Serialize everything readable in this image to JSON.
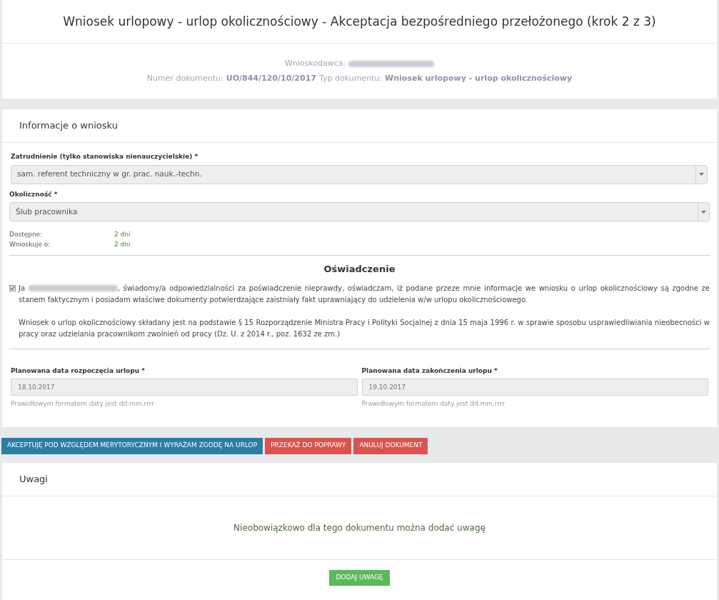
{
  "title": "Wniosek urlopowy - urlop okolicznościowy - Akceptacja bezpośredniego przełożonego (krok 2 z 3)",
  "header": {
    "applicant_label": "Wnioskodawca:",
    "doc_number_label": "Numer dokumentu:",
    "doc_number": "UO/844/120/10/2017",
    "doc_type_label": "Typ dokumentu:",
    "doc_type": "Wniosek urlopowy - urlop okolicznościowy"
  },
  "info": {
    "title": "Informacje o wniosku",
    "selects": [
      {
        "label": "Zatrudnienie (tylko stanowiska nienauczycielskie) *",
        "value": "sam. referent techniczny w gr. prac. nauk.-techn."
      },
      {
        "label": "Okoliczność *",
        "value": "Ślub pracownika"
      }
    ],
    "summary": [
      {
        "label": "Dostępne:",
        "value": "2 dni"
      },
      {
        "label": "Wnioskuje o:",
        "value": "2 dni"
      }
    ],
    "declaration": {
      "title": "Oświadczenie",
      "checked": true,
      "prefix": "Ja",
      "text": ", świadomy/a odpowiedzialności za poświadczenie nieprawdy, oświadczam, iż podane przeze mnie informacje we wniosku o urlop okolicznościowy są zgodne ze stanem faktycznym i posiadam właściwe dokumenty potwierdzające zaistniały fakt uprawniający do udzielenia w/w urlopu okolicznościowego.",
      "note": "Wniosek o urlop okolicznościowy składany jest na podstawie § 15 Rozporządzenie Ministra Pracy i Polityki Socjalnej z dnia 15 maja 1996 r. w sprawie sposobu usprawiedliwiania nieobecności w pracy oraz udzielania pracownikom zwolnień od pracy (Dz. U. z 2014 r., poz. 1632 ze zm.)"
    },
    "dates": [
      {
        "label": "Planowana data rozpoczęcia urlopu *",
        "value": "18.10.2017",
        "hint": "Prawidłowym formatem daty jest dd.mm.rrrr"
      },
      {
        "label": "Planowana data zakończenia urlopu *",
        "value": "19.10.2017",
        "hint": "Prawidłowym formatem daty jest dd.mm.rrrr"
      }
    ]
  },
  "actions": [
    {
      "label": "AKCEPTUJĘ POD WZGLĘDEM MERYTORYCZNYM I WYRAŻAM ZGODĘ NA URLOP",
      "kind": "primary"
    },
    {
      "label": "PRZEKAŻ DO POPRAWY",
      "kind": "danger"
    },
    {
      "label": "ANULUJ DOKUMENT",
      "kind": "danger"
    }
  ],
  "notes": {
    "title": "Uwagi",
    "message": "Nieobowiązkowo dla tego dokumentu można dodać uwagę",
    "button": "DODAJ UWAGĘ"
  }
}
